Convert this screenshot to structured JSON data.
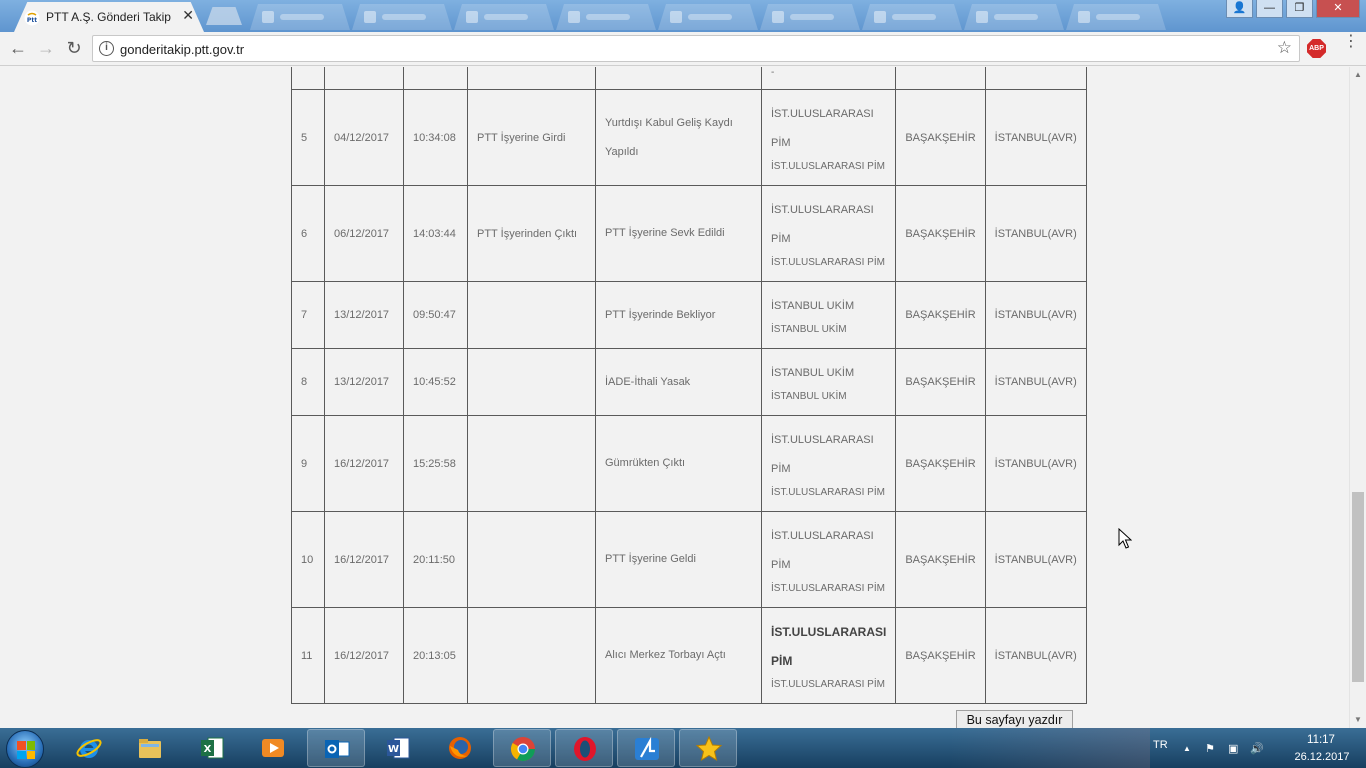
{
  "tab": {
    "title": "PTT A.Ş. Gönderi Takip",
    "close": "✕"
  },
  "window_controls": {
    "user": "👤",
    "minimize": "—",
    "maximize": "❐",
    "close": "✕"
  },
  "toolbar": {
    "back": "←",
    "forward": "→",
    "reload": "↻",
    "url": "gonderitakip.ptt.gov.tr",
    "info": "i",
    "bookmark": "☆",
    "abp": "ABP",
    "menu": "⋮"
  },
  "table": {
    "partial_row": {
      "office_sub": "-"
    },
    "rows": [
      {
        "no": "5",
        "date": "04/12/2017",
        "time": "10:34:08",
        "event": "PTT İşyerine Girdi",
        "description": "Yurtdışı Kabul Geliş Kaydı Yapıldı",
        "office": "İST.ULUSLARARASI PİM",
        "office_sub": "İST.ULUSLARARASI PİM",
        "unit": "BAŞAKŞEHİR",
        "city": "İSTANBUL(AVR)",
        "bold": false
      },
      {
        "no": "6",
        "date": "06/12/2017",
        "time": "14:03:44",
        "event": "PTT İşyerinden Çıktı",
        "description": "PTT İşyerine Sevk Edildi",
        "office": "İST.ULUSLARARASI PİM",
        "office_sub": "İST.ULUSLARARASI PİM",
        "unit": "BAŞAKŞEHİR",
        "city": "İSTANBUL(AVR)",
        "bold": false
      },
      {
        "no": "7",
        "date": "13/12/2017",
        "time": "09:50:47",
        "event": "",
        "description": "PTT İşyerinde Bekliyor",
        "office": "İSTANBUL UKİM",
        "office_sub": "İSTANBUL UKİM",
        "unit": "BAŞAKŞEHİR",
        "city": "İSTANBUL(AVR)",
        "bold": false
      },
      {
        "no": "8",
        "date": "13/12/2017",
        "time": "10:45:52",
        "event": "",
        "description": "İADE-İthali Yasak",
        "office": "İSTANBUL UKİM",
        "office_sub": "İSTANBUL UKİM",
        "unit": "BAŞAKŞEHİR",
        "city": "İSTANBUL(AVR)",
        "bold": false
      },
      {
        "no": "9",
        "date": "16/12/2017",
        "time": "15:25:58",
        "event": "",
        "description": "Gümrükten Çıktı",
        "office": "İST.ULUSLARARASI PİM",
        "office_sub": "İST.ULUSLARARASI PİM",
        "unit": "BAŞAKŞEHİR",
        "city": "İSTANBUL(AVR)",
        "bold": false
      },
      {
        "no": "10",
        "date": "16/12/2017",
        "time": "20:11:50",
        "event": "",
        "description": "PTT İşyerine Geldi",
        "office": "İST.ULUSLARARASI PİM",
        "office_sub": "İST.ULUSLARARASI PİM",
        "unit": "BAŞAKŞEHİR",
        "city": "İSTANBUL(AVR)",
        "bold": false
      },
      {
        "no": "11",
        "date": "16/12/2017",
        "time": "20:13:05",
        "event": "",
        "description": "Alıcı Merkez Torbayı Açtı",
        "office": "İST.ULUSLARARASI PİM",
        "office_sub": "İST.ULUSLARARASI PİM",
        "unit": "BAŞAKŞEHİR",
        "city": "İSTANBUL(AVR)",
        "bold": true
      }
    ]
  },
  "print_button": "Bu sayfayı yazdır",
  "taskbar": {
    "apps": [
      "internet-explorer",
      "file-explorer",
      "excel",
      "media-player",
      "outlook",
      "word",
      "firefox",
      "chrome",
      "opera",
      "app-blue",
      "app-star"
    ],
    "tray": {
      "lang": "TR",
      "arrow": "▲",
      "flag": "⚑",
      "network": "▣",
      "volume": "🔊",
      "time": "11:17",
      "date": "26.12.2017"
    }
  },
  "colors": {
    "taskbar": "#1c4f77",
    "tabstrip": "#6fa3d8",
    "text": "#6b6b6b",
    "border": "#5a5a5a"
  }
}
